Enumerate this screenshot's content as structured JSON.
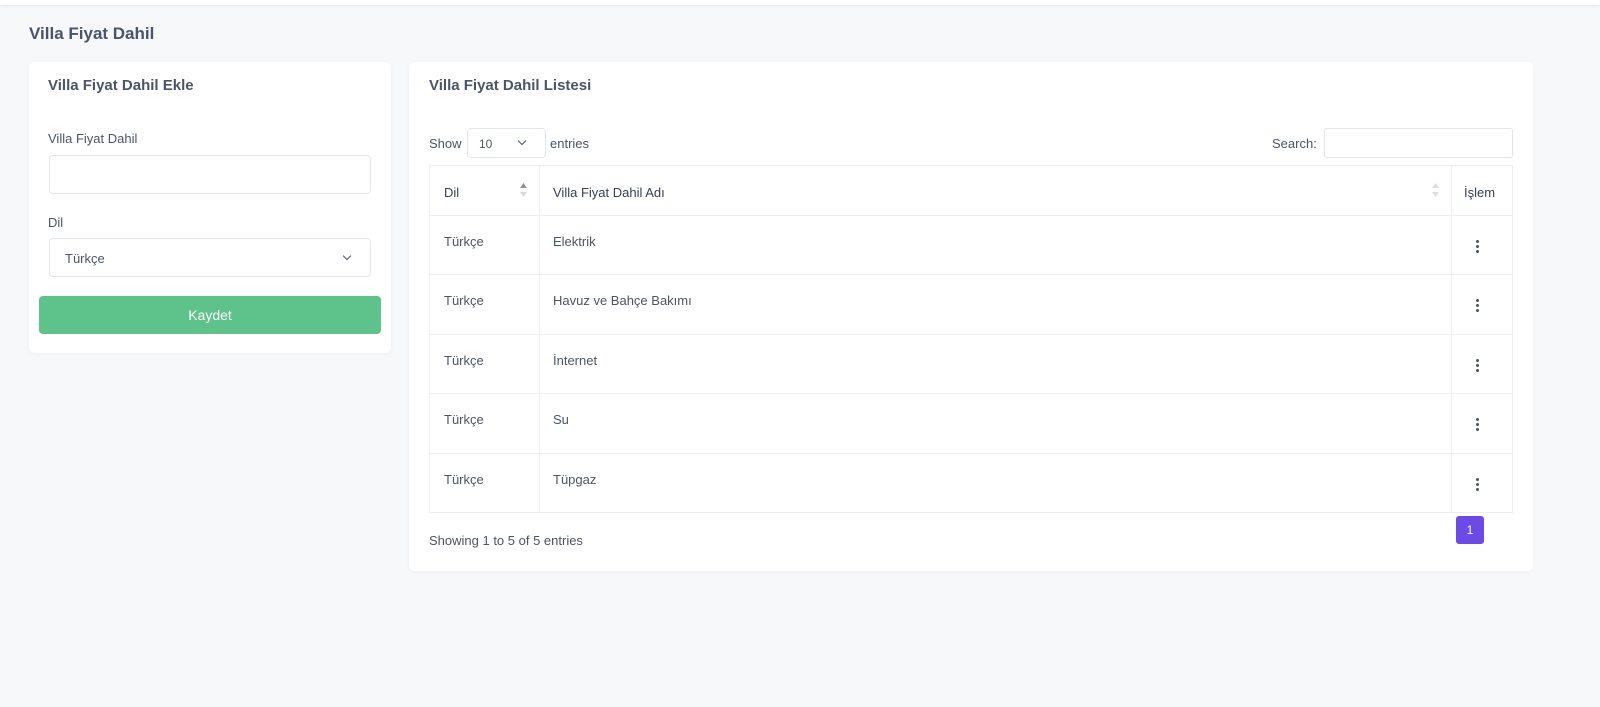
{
  "page": {
    "title": "Villa Fiyat Dahil"
  },
  "form": {
    "title": "Villa Fiyat Dahil Ekle",
    "name_label": "Villa Fiyat Dahil",
    "name_value": "",
    "lang_label": "Dil",
    "lang_selected": "Türkçe",
    "save_label": "Kaydet"
  },
  "list": {
    "title": "Villa Fiyat Dahil Listesi",
    "show_label": "Show",
    "page_length": "10",
    "entries_label": "entries",
    "search_label": "Search:",
    "search_value": "",
    "columns": [
      "Dil",
      "Villa Fiyat Dahil Adı",
      "İşlem"
    ],
    "rows": [
      {
        "lang": "Türkçe",
        "name": "Elektrik"
      },
      {
        "lang": "Türkçe",
        "name": "Havuz ve Bahçe Bakımı"
      },
      {
        "lang": "Türkçe",
        "name": "İnternet"
      },
      {
        "lang": "Türkçe",
        "name": "Su"
      },
      {
        "lang": "Türkçe",
        "name": "Tüpgaz"
      }
    ],
    "info": "Showing 1 to 5 of 5 entries",
    "current_page": "1"
  },
  "colors": {
    "save_button": "#5ec38a",
    "pagination_active": "#6c4ae8",
    "page_background": "#f7f8fa"
  },
  "icons": {
    "sort": "sort-icon",
    "actions": "kebab-menu-icon",
    "dropdown": "chevron-down-icon"
  }
}
